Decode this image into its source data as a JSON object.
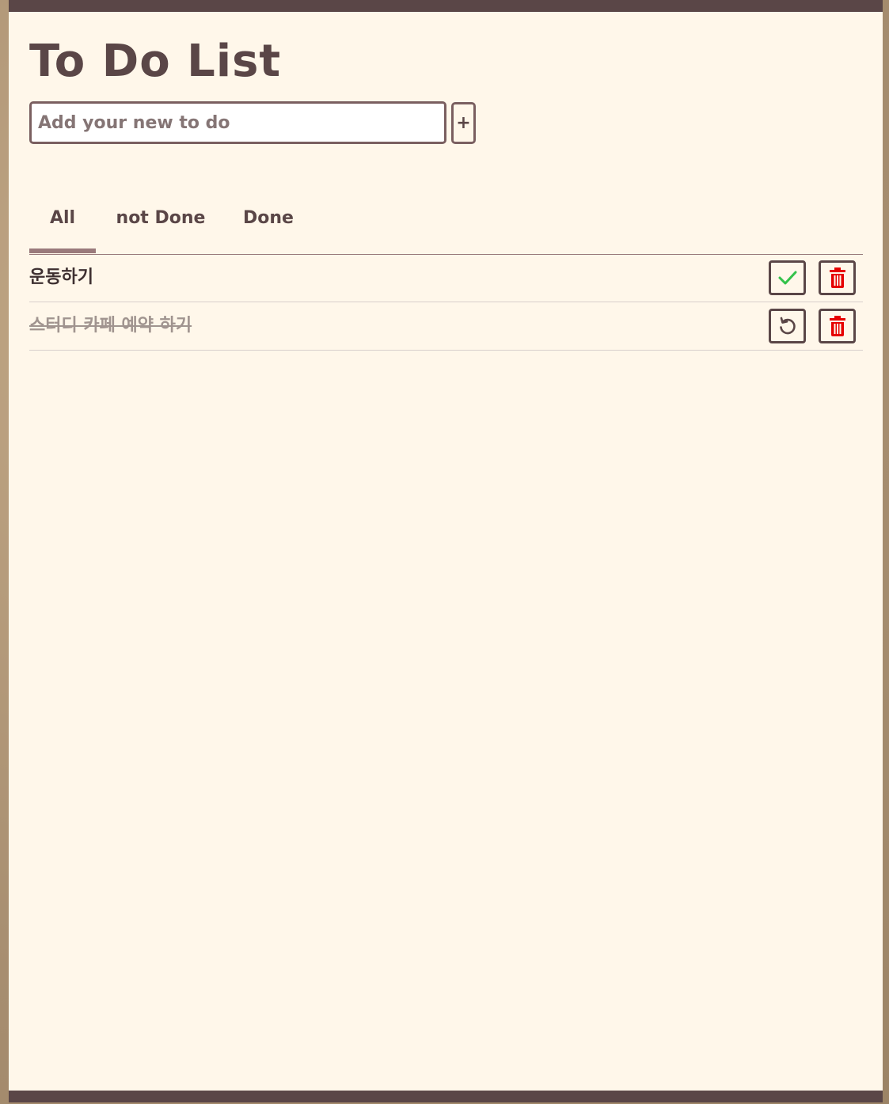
{
  "app": {
    "title": "To Do List"
  },
  "new_todo": {
    "placeholder": "Add your new to do",
    "value": "",
    "add_label": "+"
  },
  "tabs": [
    {
      "label": "All",
      "active": true
    },
    {
      "label": "not Done",
      "active": false
    },
    {
      "label": "Done",
      "active": false
    }
  ],
  "todos": [
    {
      "text": "운동하기",
      "done": false,
      "toggle_icon": "check-icon",
      "delete_icon": "trash-icon"
    },
    {
      "text": "스터디 카페 예약 하기",
      "done": true,
      "toggle_icon": "undo-icon",
      "delete_icon": "trash-icon"
    }
  ],
  "colors": {
    "brand": "#5a4647",
    "paper": "#fff7ea",
    "tab_indicator": "#9a7a7b",
    "check": "#33c24a",
    "delete": "#e60000",
    "done_text": "#a0948f"
  }
}
